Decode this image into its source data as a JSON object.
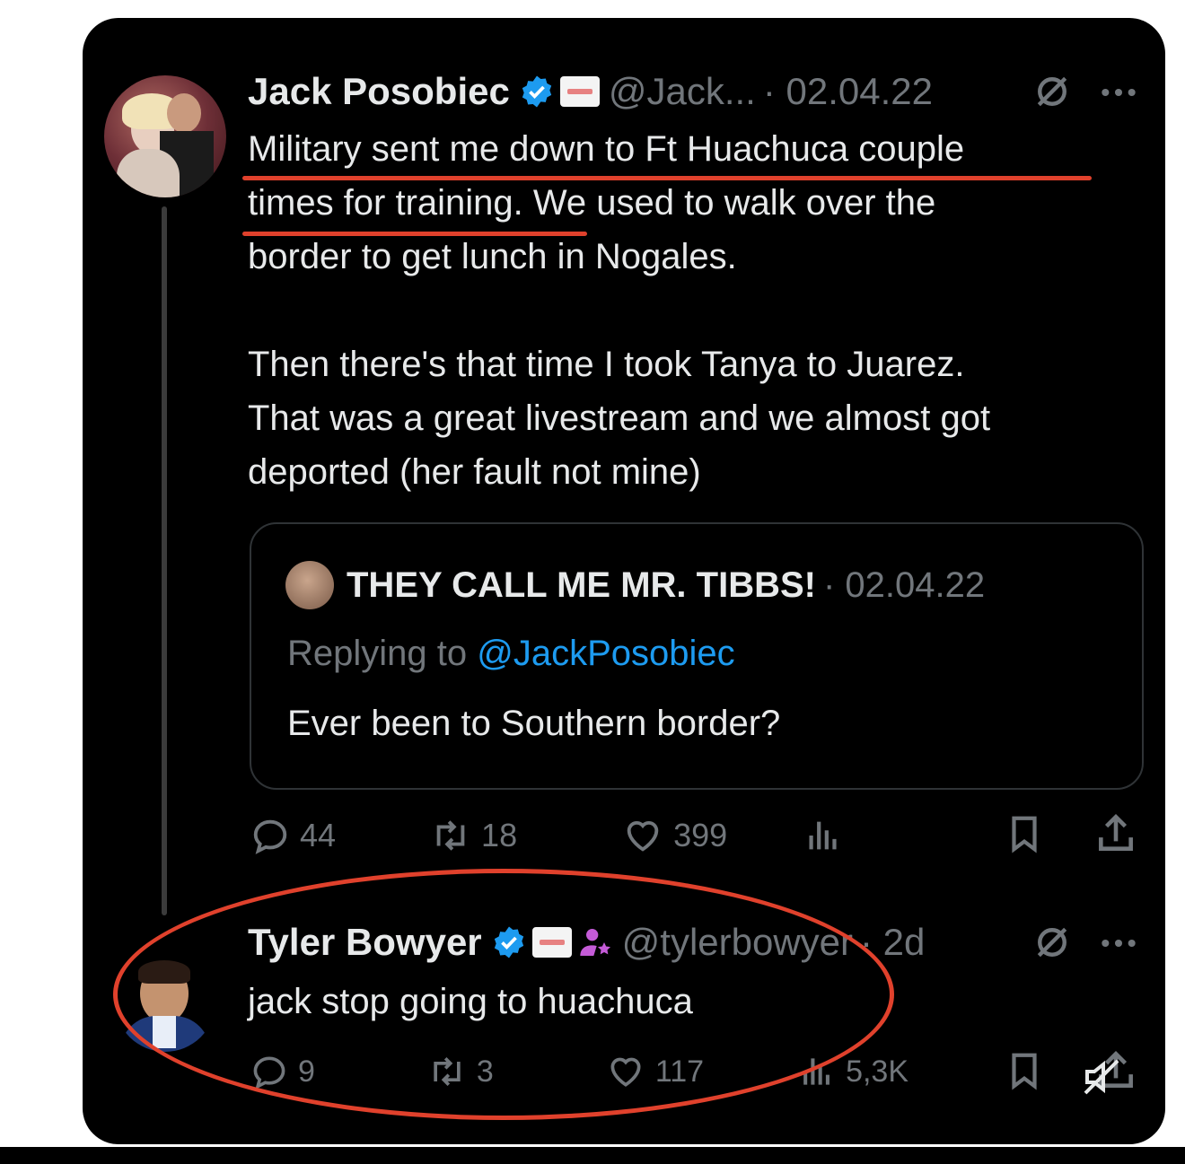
{
  "tweet1": {
    "name": "Jack Posobiec",
    "handle": "@Jack...",
    "date": "· 02.04.22",
    "lines": [
      "Military sent me down to Ft Huachuca couple",
      "times for training. We used to walk over the",
      "border to get lunch in Nogales.",
      "Then there's that time I took Tanya to Juarez.",
      "That was a great livestream and we almost got",
      "deported (her fault not mine)"
    ],
    "quote": {
      "name": "THEY CALL ME MR. TIBBS!",
      "date": "· 02.04.22",
      "replying_prefix": "Replying to ",
      "replying_handle": "@JackPosobiec",
      "text": "Ever been to Southern border?"
    },
    "stats": {
      "replies": "44",
      "reposts": "18",
      "likes": "399"
    }
  },
  "tweet2": {
    "name": "Tyler Bowyer",
    "handle": "@tylerbowyer",
    "date": "· 2d",
    "text": "jack stop going to huachuca",
    "stats": {
      "replies": "9",
      "reposts": "3",
      "likes": "117",
      "views": "5,3K"
    }
  },
  "colors": {
    "verified": "#1d9bf0",
    "annotation": "#e0412c",
    "link": "#1d9bf0",
    "affiliate": "#c45bd7"
  }
}
